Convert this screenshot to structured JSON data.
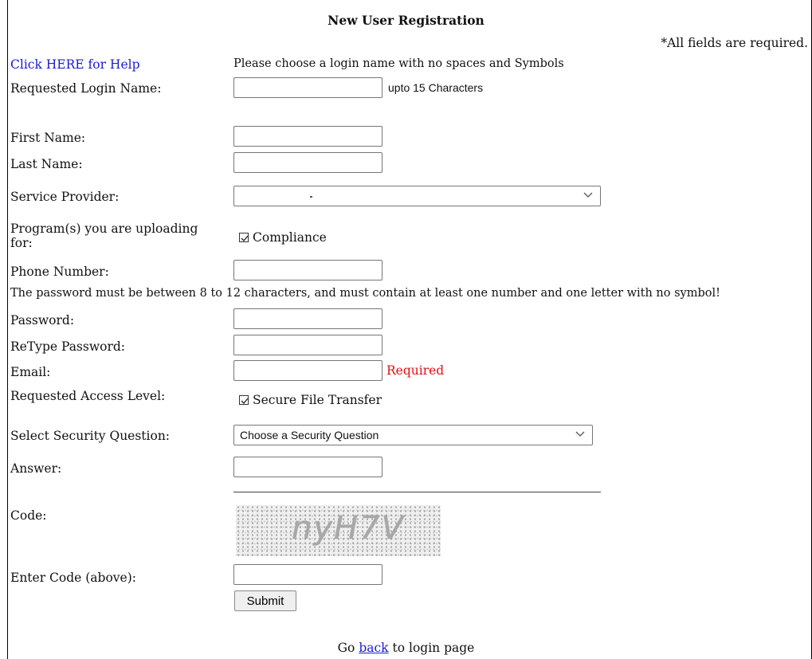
{
  "form": {
    "title": "New User Registration",
    "required_note": "*All fields are required.",
    "help_link": "Click HERE for Help",
    "login_hint": "Please choose a login name with no spaces and Symbols",
    "login_name": {
      "label": "Requested Login Name:",
      "value": "",
      "hint": "upto 15 Characters"
    },
    "first_name": {
      "label": "First Name:",
      "value": ""
    },
    "last_name": {
      "label": "Last Name:",
      "value": ""
    },
    "service_provider": {
      "label": "Service Provider:",
      "selected": ""
    },
    "programs": {
      "label": "Program(s) you are uploading for:",
      "option": "Compliance",
      "checked": true
    },
    "phone": {
      "label": "Phone Number:",
      "value": ""
    },
    "password_rule": "The password must be between 8 to 12 characters, and must contain at least one number and one letter with no symbol!",
    "password": {
      "label": "Password:",
      "value": ""
    },
    "retype_password": {
      "label": "ReType Password:",
      "value": ""
    },
    "email": {
      "label": "Email:",
      "value": "",
      "required_text": "Required"
    },
    "access_level": {
      "label": "Requested Access Level:",
      "option": "Secure File Transfer",
      "checked": true
    },
    "security_question": {
      "label": "Select Security Question:",
      "selected": "Choose a Security Question"
    },
    "answer": {
      "label": "Answer:",
      "value": ""
    },
    "code": {
      "label": "Code:",
      "captcha_text": "nyH7V"
    },
    "enter_code": {
      "label": "Enter Code (above):",
      "value": ""
    },
    "submit_label": "Submit"
  },
  "footer": {
    "prefix": "Go",
    "link": "back",
    "suffix": "to login page"
  },
  "colors": {
    "link": "#1a1ad6",
    "required": "#e01010"
  }
}
